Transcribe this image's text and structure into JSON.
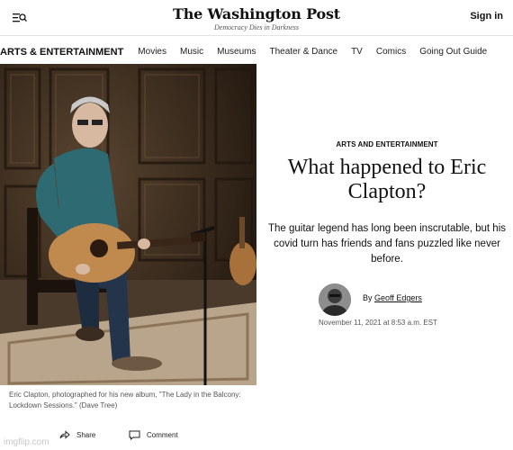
{
  "header": {
    "brand": "The Washington Post",
    "tagline": "Democracy Dies in Darkness",
    "signin_label": "Sign in",
    "menu_icon": "menu-search-icon"
  },
  "nav": {
    "section": "ARTS & ENTERTAINMENT",
    "items": [
      "Movies",
      "Music",
      "Museums",
      "Theater & Dance",
      "TV",
      "Comics",
      "Going Out Guide"
    ]
  },
  "article": {
    "kicker": "ARTS AND ENTERTAINMENT",
    "headline": "What happened to Eric Clapton?",
    "dek": "The guitar legend has long been inscrutable, but his covid turn has friends and fans puzzled like never before.",
    "byline_prefix": "By",
    "author": "Geoff Edgers",
    "date": "November 11, 2021 at 8:53 a.m. EST",
    "caption": "Eric Clapton, photographed for his new album, \"The Lady in the Balcony: Lockdown Sessions.\" (Dave Tree)"
  },
  "actions": {
    "share_label": "Share",
    "comment_label": "Comment"
  },
  "watermark": "imgflip.com",
  "colors": {
    "text": "#111111",
    "muted": "#555555",
    "divider": "#e4e4e4",
    "panel_wood": "#3b2a1c"
  }
}
